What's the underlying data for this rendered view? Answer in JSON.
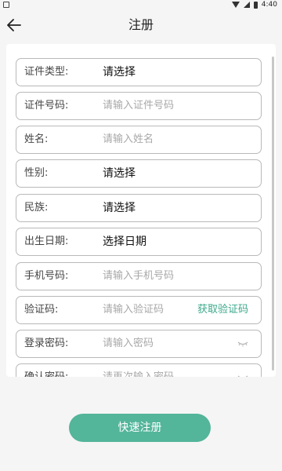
{
  "status_bar": {
    "time": "4:40"
  },
  "header": {
    "title": "注册"
  },
  "form": {
    "fields": [
      {
        "label": "证件类型:",
        "value": "请选择",
        "kind": "select"
      },
      {
        "label": "证件号码:",
        "placeholder": "请输入证件号码",
        "kind": "input"
      },
      {
        "label": "姓名:",
        "placeholder": "请输入姓名",
        "kind": "input"
      },
      {
        "label": "性别:",
        "value": "请选择",
        "kind": "select"
      },
      {
        "label": "民族:",
        "value": "请选择",
        "kind": "select"
      },
      {
        "label": "出生日期:",
        "value": "选择日期",
        "kind": "select"
      },
      {
        "label": "手机号码:",
        "placeholder": "请输入手机号码",
        "kind": "input"
      },
      {
        "label": "验证码:",
        "placeholder": "请输入验证码",
        "kind": "input",
        "action": "获取验证码"
      },
      {
        "label": "登录密码:",
        "placeholder": "请输入密码",
        "kind": "password"
      },
      {
        "label": "确认密码:",
        "placeholder": "请再次输入密码",
        "kind": "password"
      }
    ]
  },
  "submit_label": "快速注册",
  "colors": {
    "accent": "#53b59a",
    "link": "#3aa98b",
    "background": "#f5f5f5"
  }
}
